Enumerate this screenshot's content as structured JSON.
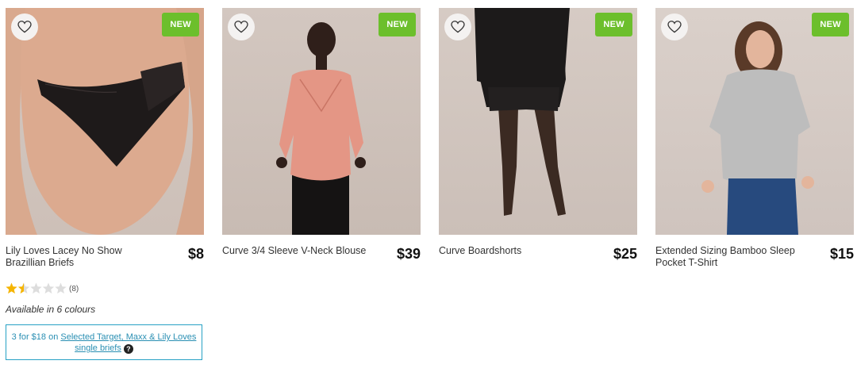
{
  "products": [
    {
      "name": "Lily Loves Lacey No Show Brazillian Briefs",
      "price": "$8",
      "badge": "NEW",
      "rating_value": 1.5,
      "rating_max": 5,
      "rating_count": "(8)",
      "availability": "Available in 6 colours",
      "promo": {
        "prefix": "3 for $18 on ",
        "link": "Selected Target, Maxx & Lily Loves single briefs"
      }
    },
    {
      "name": "Curve 3/4 Sleeve V-Neck Blouse",
      "price": "$39",
      "badge": "NEW"
    },
    {
      "name": "Curve Boardshorts",
      "price": "$25",
      "badge": "NEW"
    },
    {
      "name": "Extended Sizing Bamboo Sleep Pocket T-Shirt",
      "price": "$15",
      "badge": "NEW"
    }
  ],
  "colors": {
    "badge": "#6cbf2c",
    "promo_border": "#27a1c5",
    "star_filled": "#f5b400",
    "star_empty": "#dddddd"
  },
  "icons": {
    "favourite": "heart-outline-icon",
    "help": "question-icon",
    "rating": "star-icon"
  }
}
